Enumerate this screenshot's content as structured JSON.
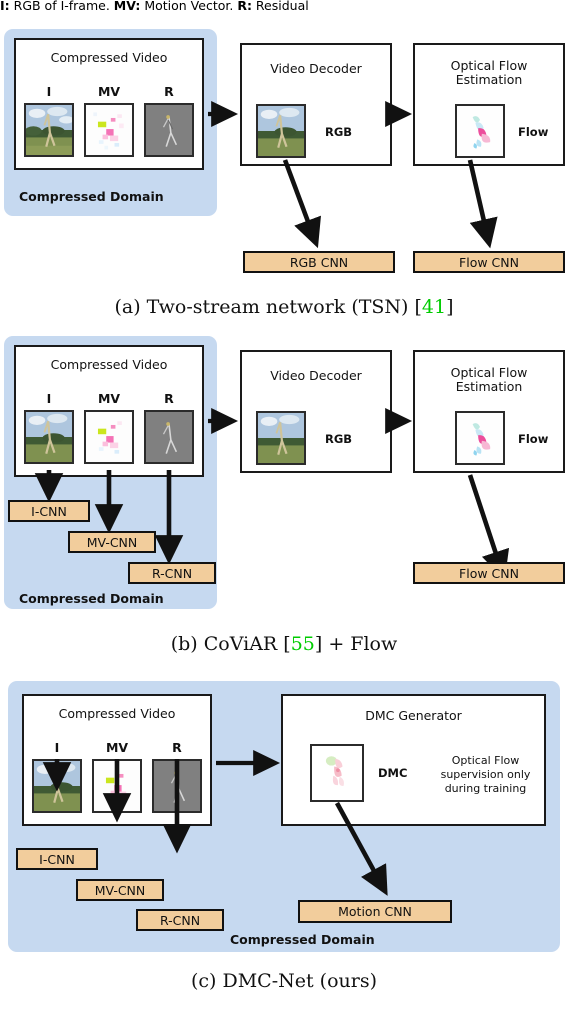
{
  "legend": {
    "i_key": "I:",
    "i_text": " RGB of I-frame. ",
    "mv_key": "MV:",
    "mv_text": " Motion Vector. ",
    "r_key": "R:",
    "r_text": " Residual"
  },
  "colors": {
    "compressed_domain_panel": "#c6d9f0",
    "cnn_box": "#f2cd9c",
    "border": "#111111",
    "citation_green": "#00cc00"
  },
  "panels": [
    {
      "id": "a",
      "caption_prefix": "(a) Two-stream network (TSN) [",
      "caption_cite": "41",
      "caption_suffix": "]",
      "domain_label": "Compressed Domain",
      "compressed_video": {
        "title": "Compressed Video",
        "streams": [
          {
            "label": "I",
            "kind": "iframe"
          },
          {
            "label": "MV",
            "kind": "motionvector"
          },
          {
            "label": "R",
            "kind": "residual"
          }
        ]
      },
      "boxes": [
        {
          "name": "video-decoder",
          "title": "Video Decoder",
          "thumb_label": "RGB",
          "kind": "rgb"
        },
        {
          "name": "optical-flow-estimation",
          "title": "Optical Flow\nEstimation",
          "thumb_label": "Flow",
          "kind": "flow"
        }
      ],
      "cnns": [
        {
          "name": "rgb-cnn",
          "label": "RGB CNN"
        },
        {
          "name": "flow-cnn",
          "label": "Flow CNN"
        }
      ]
    },
    {
      "id": "b",
      "caption_prefix": "(b) CoViAR [",
      "caption_cite": "55",
      "caption_suffix": "] + Flow",
      "domain_label": "Compressed Domain",
      "compressed_video": {
        "title": "Compressed Video",
        "streams": [
          {
            "label": "I",
            "kind": "iframe"
          },
          {
            "label": "MV",
            "kind": "motionvector"
          },
          {
            "label": "R",
            "kind": "residual"
          }
        ]
      },
      "boxes": [
        {
          "name": "video-decoder",
          "title": "Video Decoder",
          "thumb_label": "RGB",
          "kind": "rgb"
        },
        {
          "name": "optical-flow-estimation",
          "title": "Optical Flow\nEstimation",
          "thumb_label": "Flow",
          "kind": "flow"
        }
      ],
      "cnns": [
        {
          "name": "i-cnn",
          "label": "I-CNN"
        },
        {
          "name": "mv-cnn",
          "label": "MV-CNN"
        },
        {
          "name": "r-cnn",
          "label": "R-CNN"
        },
        {
          "name": "flow-cnn",
          "label": "Flow CNN"
        }
      ]
    },
    {
      "id": "c",
      "caption_prefix": "(c) DMC-Net (ours)",
      "caption_cite": "",
      "caption_suffix": "",
      "domain_label": "Compressed Domain",
      "compressed_video": {
        "title": "Compressed Video",
        "streams": [
          {
            "label": "I",
            "kind": "iframe"
          },
          {
            "label": "MV",
            "kind": "motionvector"
          },
          {
            "label": "R",
            "kind": "residual"
          }
        ]
      },
      "generator": {
        "name": "dmc-generator",
        "title": "DMC Generator",
        "thumb_label": "DMC",
        "kind": "dmc",
        "note": "Optical Flow\nsupervision only\nduring training"
      },
      "cnns": [
        {
          "name": "i-cnn",
          "label": "I-CNN"
        },
        {
          "name": "mv-cnn",
          "label": "MV-CNN"
        },
        {
          "name": "r-cnn",
          "label": "R-CNN"
        },
        {
          "name": "motion-cnn",
          "label": "Motion CNN"
        }
      ]
    }
  ]
}
